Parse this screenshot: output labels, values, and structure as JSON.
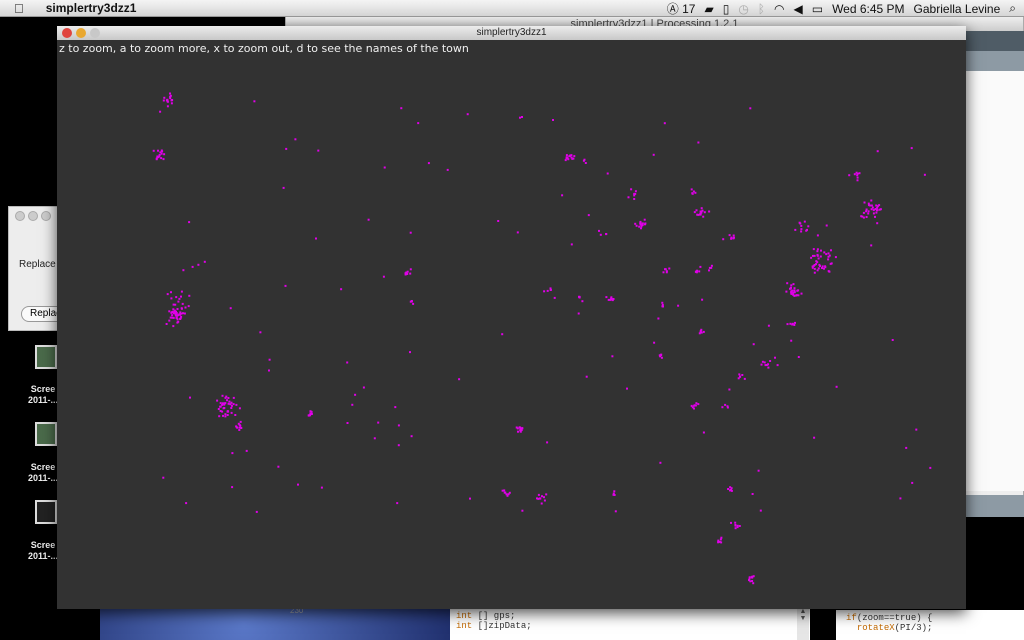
{
  "menubar": {
    "app_name": "simplertry3dzz1",
    "adobe_count": "17",
    "clock": "Wed 6:45 PM",
    "user": "Gabriella Levine"
  },
  "background_window": {
    "title": "simplertry3dzz1 | Processing 1.2.1",
    "line_number": "230",
    "code_left": [
      [
        "int",
        "[] gps;"
      ],
      [
        "int",
        "[]zipData;"
      ]
    ],
    "code_right": [
      [
        "if",
        "(zoom==true) {"
      ],
      [
        "rotateX",
        "(PI/3);"
      ]
    ]
  },
  "dialog": {
    "label": "Replace w",
    "button": "Replac"
  },
  "desktop_icons": [
    {
      "label1": "Scree",
      "label2": "2011-..."
    },
    {
      "label1": "Scree",
      "label2": "2011-..."
    },
    {
      "label1": "Scree",
      "label2": "2011-..."
    }
  ],
  "sketch": {
    "title": "simplertry3dzz1",
    "hint": "z to zoom, a to zoom more, x to zoom out, d to see the names of the town",
    "background": "#323232",
    "dot_color": "#e000e8"
  }
}
